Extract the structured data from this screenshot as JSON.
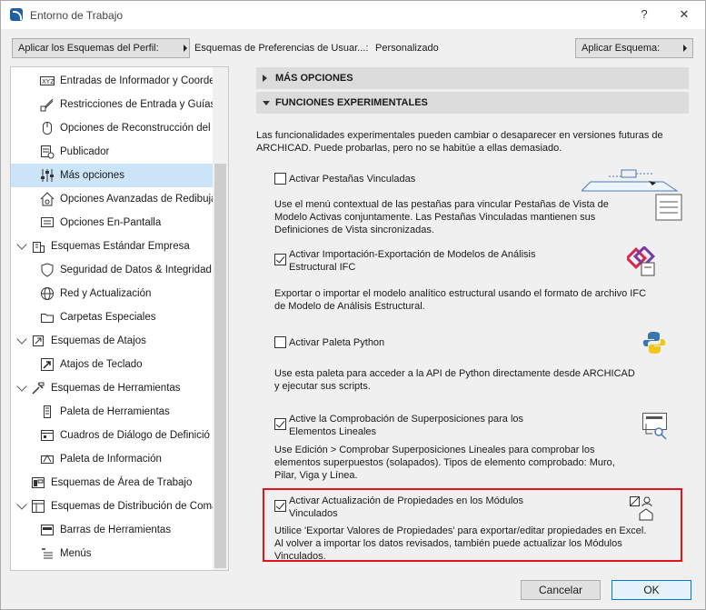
{
  "window": {
    "title": "Entorno de Trabajo",
    "help_btn": "?",
    "close_btn": "✕"
  },
  "toolbar": {
    "apply_profile": "Aplicar los Esquemas del Perfil:",
    "scheme_name": "Esquemas de Preferencias de Usuar...:",
    "scheme_value": "Personalizado",
    "apply_scheme": "Aplicar Esquema:"
  },
  "sidebar": {
    "items": [
      {
        "label": "Entradas de Informador y Coorde",
        "icon": "xyz-icon",
        "level": 2
      },
      {
        "label": "Restricciones de Entrada y Guías",
        "icon": "ruler-icon",
        "level": 2
      },
      {
        "label": "Opciones de Reconstrucción del",
        "icon": "mouse-icon",
        "level": 2
      },
      {
        "label": "Publicador",
        "icon": "publisher-icon",
        "level": 2
      },
      {
        "label": "Más opciones",
        "icon": "sliders-icon",
        "level": 2,
        "selected": true
      },
      {
        "label": "Opciones Avanzadas de Redibuja",
        "icon": "house-gear-icon",
        "level": 2
      },
      {
        "label": "Opciones En-Pantalla",
        "icon": "screen-list-icon",
        "level": 2
      },
      {
        "label": "Esquemas Estándar Empresa",
        "icon": "building-icon",
        "level": 1,
        "expanded": true
      },
      {
        "label": "Seguridad de Datos & Integridad",
        "icon": "shield-icon",
        "level": 2
      },
      {
        "label": "Red y Actualización",
        "icon": "globe-icon",
        "level": 2
      },
      {
        "label": "Carpetas Especiales",
        "icon": "folder-icon",
        "level": 2
      },
      {
        "label": "Esquemas de Atajos",
        "icon": "shortcut-folder-icon",
        "level": 1,
        "expanded": true
      },
      {
        "label": "Atajos de Teclado",
        "icon": "shortcut-arrow-icon",
        "level": 2
      },
      {
        "label": "Esquemas de Herramientas",
        "icon": "tools-folder-icon",
        "level": 1,
        "expanded": true
      },
      {
        "label": "Paleta de Herramientas",
        "icon": "toolbox-icon",
        "level": 2
      },
      {
        "label": "Cuadros de Diálogo de Definició",
        "icon": "dialog-icon",
        "level": 2
      },
      {
        "label": "Paleta de Información",
        "icon": "info-palette-icon",
        "level": 2
      },
      {
        "label": "Esquemas de Área de Trabajo",
        "icon": "workspace-icon",
        "level": 1
      },
      {
        "label": "Esquemas de Distribución de Coma",
        "icon": "command-layout-icon",
        "level": 1,
        "expanded": true
      },
      {
        "label": "Barras de Herramientas",
        "icon": "toolbar-icon",
        "level": 2
      },
      {
        "label": "Menús",
        "icon": "menu-icon",
        "level": 2
      }
    ]
  },
  "content": {
    "sections": [
      {
        "label": "MÁS OPCIONES",
        "expanded": false
      },
      {
        "label": "FUNCIONES EXPERIMENTALES",
        "expanded": true
      }
    ],
    "intro": "Las funcionalidades experimentales pueden cambiar o desaparecer en versiones futuras de ARCHICAD. Puede probarlas, pero no se habitúe a ellas demasiado.",
    "features": [
      {
        "checkbox_label": "Activar Pestañas Vinculadas",
        "checked": false,
        "description": "Use el menú contextual de las pestañas para vincular Pestañas de Vista de Modelo Activas conjuntamente. Las Pestañas Vinculadas mantienen sus Definiciones de Vista sincronizadas.",
        "icon": "linked-tabs-icon"
      },
      {
        "checkbox_label": "Activar Importación-Exportación de Modelos de Análisis Estructural IFC",
        "checked": true,
        "description": "Exportar o importar el modelo analítico estructural usando el formato de archivo IFC de Modelo de Análisis Estructural.",
        "icon": "ifc-icon"
      },
      {
        "checkbox_label": "Activar Paleta Python",
        "checked": false,
        "description": "Use esta paleta para acceder a la API de Python directamente desde ARCHICAD y ejecutar sus scripts.",
        "icon": "python-icon"
      },
      {
        "checkbox_label": "Active la Comprobación de Superposiciones para los Elementos Lineales",
        "checked": true,
        "description": "Use Edición > Comprobar Superposiciones Lineales para comprobar los elementos superpuestos (solapados). Tipos de elemento comprobado: Muro, Pilar, Viga y Línea.",
        "icon": "overlap-check-icon"
      },
      {
        "checkbox_label": "Activar Actualización de Propiedades en los Módulos Vinculados",
        "checked": true,
        "description": "Utilice 'Exportar Valores de Propiedades' para exportar/editar propiedades en Excel. Al volver a importar los datos revisados, también puede actualizar los Módulos Vinculados.",
        "icon": "linked-modules-icon"
      }
    ]
  },
  "footer": {
    "cancel": "Cancelar",
    "ok": "OK"
  },
  "colors": {
    "selection": "#cce4f7",
    "highlight_border": "#e0141b",
    "section_header": "#dcdcdc"
  }
}
